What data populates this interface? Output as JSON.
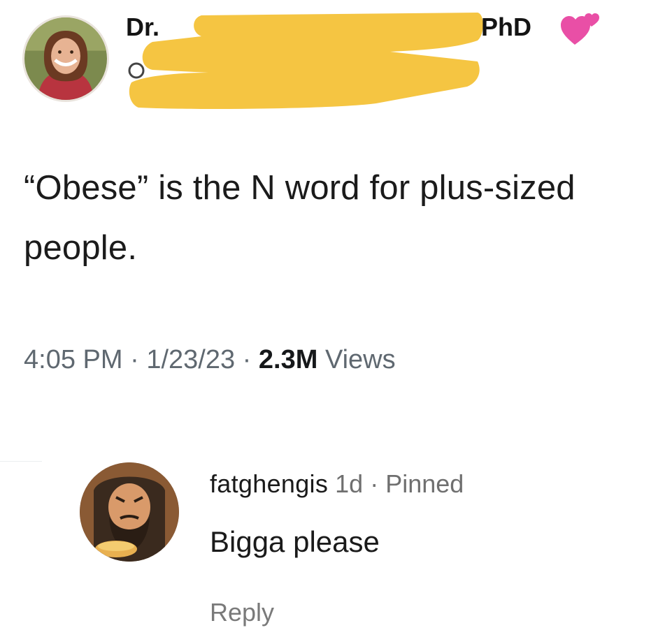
{
  "tweet": {
    "author": {
      "name_prefix": "Dr.",
      "name_suffix": "PhD",
      "badge_icon": "two-hearts-icon",
      "redaction_color": "#f5c542"
    },
    "text": "“Obese” is the N word for plus-sized people.",
    "meta": {
      "time": "4:05 PM",
      "separator": "·",
      "date": "1/23/23",
      "views_count": "2.3M",
      "views_label": "Views"
    }
  },
  "comment": {
    "username": "fatghengis",
    "time": "1d",
    "separator": "·",
    "pinned_label": "Pinned",
    "text": "Bigga please",
    "reply_label": "Reply"
  },
  "colors": {
    "redaction": "#f5c542",
    "heart": "#e94fa6",
    "meta_text": "#5f6870"
  }
}
